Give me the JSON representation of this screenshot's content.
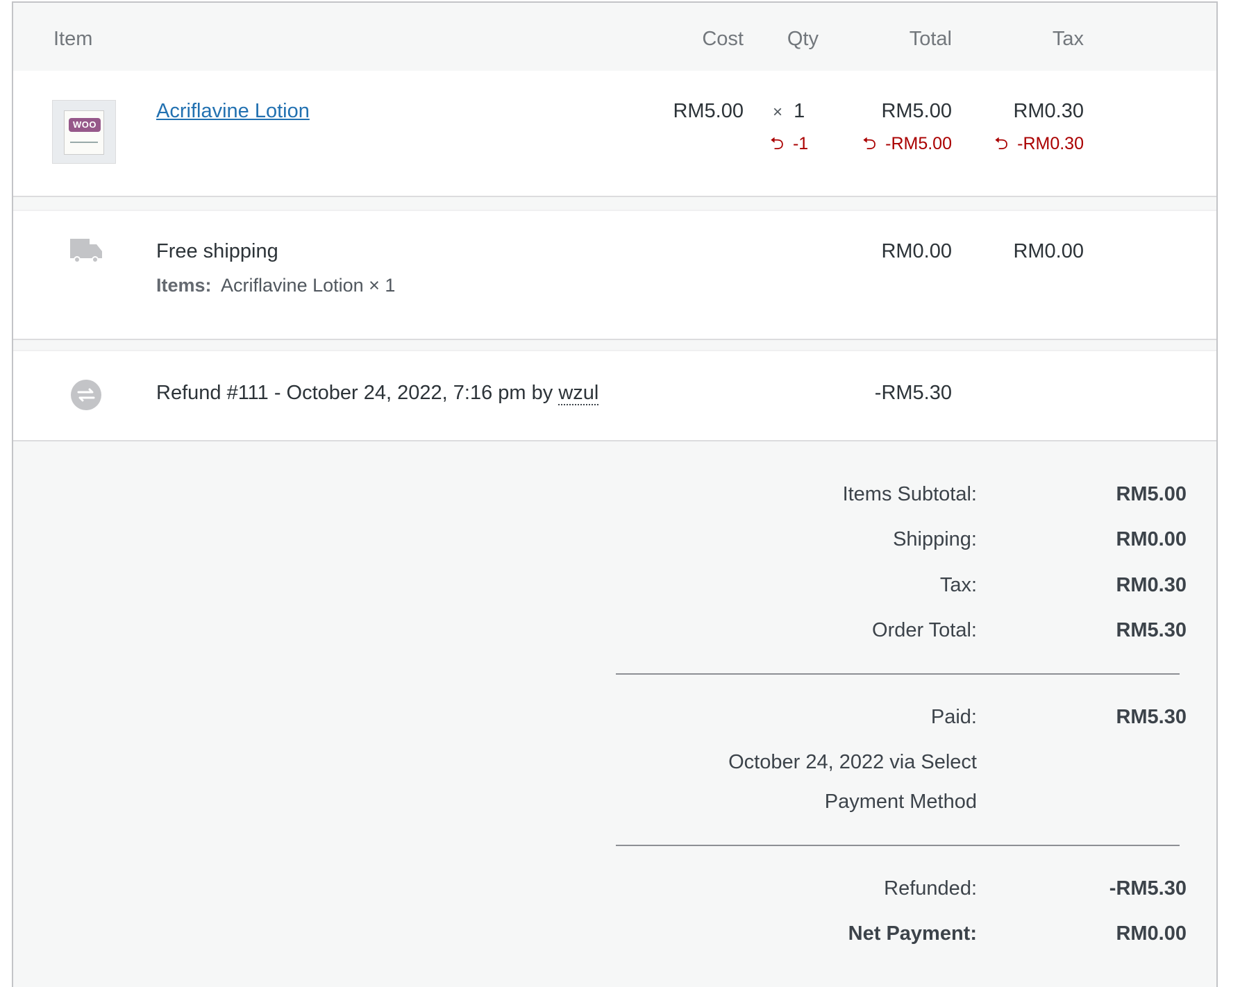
{
  "header": {
    "item": "Item",
    "cost": "Cost",
    "qty": "Qty",
    "total": "Total",
    "tax": "Tax"
  },
  "line_item": {
    "name": "Acriflavine Lotion",
    "thumb_text": "WOO",
    "cost": "RM5.00",
    "qty_symbol": "×",
    "qty": "1",
    "total": "RM5.00",
    "tax": "RM0.30",
    "refund_qty": "-1",
    "refund_total": "-RM5.00",
    "refund_tax": "-RM0.30"
  },
  "shipping": {
    "method": "Free shipping",
    "items_label": "Items:",
    "items_value": "Acriflavine Lotion × 1",
    "total": "RM0.00",
    "tax": "RM0.00"
  },
  "refund": {
    "text": "Refund #111 - October 24, 2022, 7:16 pm by",
    "user": "wzul",
    "amount": "-RM5.30"
  },
  "totals": {
    "items_subtotal_label": "Items Subtotal:",
    "items_subtotal": "RM5.00",
    "shipping_label": "Shipping:",
    "shipping": "RM0.00",
    "tax_label": "Tax:",
    "tax": "RM0.30",
    "order_total_label": "Order Total:",
    "order_total": "RM5.30",
    "paid_label": "Paid:",
    "paid": "RM5.30",
    "paid_note_line1": "October 24, 2022 via Select",
    "paid_note_line2": "Payment Method",
    "refunded_label": "Refunded:",
    "refunded": "-RM5.30",
    "net_payment_label": "Net Payment:",
    "net_payment": "RM0.00"
  },
  "colors": {
    "link": "#2271b1",
    "refund_red": "#aa0000",
    "woo_purple": "#96588a"
  },
  "icons": [
    "undo-icon",
    "truck-icon",
    "refund-exchange-icon"
  ]
}
